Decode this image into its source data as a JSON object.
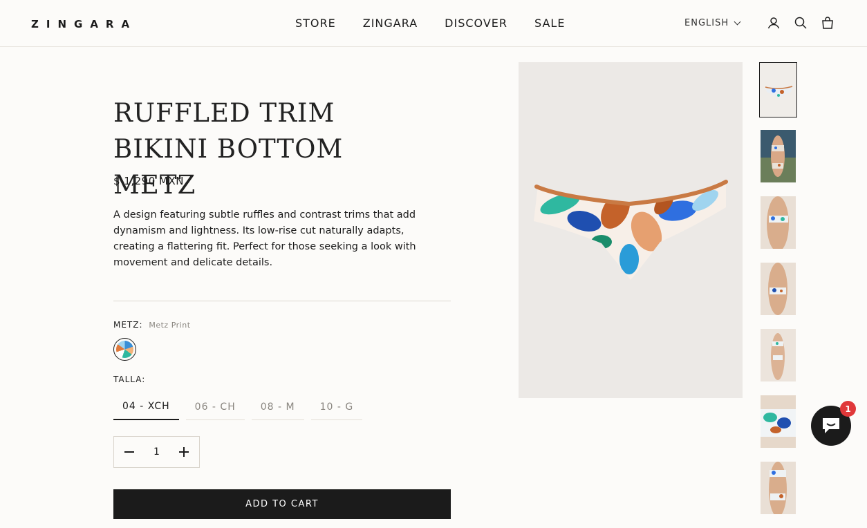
{
  "header": {
    "logo": "ZINGARA",
    "nav": [
      "STORE",
      "ZINGARA",
      "DISCOVER",
      "SALE"
    ],
    "language": "ENGLISH",
    "icons": [
      "account-icon",
      "search-icon",
      "cart-icon"
    ]
  },
  "product": {
    "title": "RUFFLED TRIM BIKINI BOTTOM METZ",
    "price": "$ 1,290 MXN",
    "description": "A design featuring subtle ruffles and contrast trims that add dynamism and lightness. Its low-rise cut naturally adapts, creating a flattering fit. Perfect for those seeking a look with movement and delicate details.",
    "color_label": "METZ:",
    "color_value": "Metz Print",
    "size_label": "TALLA:",
    "sizes": [
      "04 - XCH",
      "06 - CH",
      "08 - M",
      "10 - G"
    ],
    "selected_size": "04 - XCH",
    "quantity": "1",
    "add_to_cart": "ADD TO CART"
  },
  "gallery": {
    "thumbnail_count": 7,
    "active_index": 0
  },
  "chat": {
    "badge": "1",
    "icon": "chat-icon"
  },
  "colors": {
    "accent": "#1b1b1b",
    "background": "#fcfbf9",
    "badge": "#e0383a",
    "trim": "#c97a44"
  }
}
